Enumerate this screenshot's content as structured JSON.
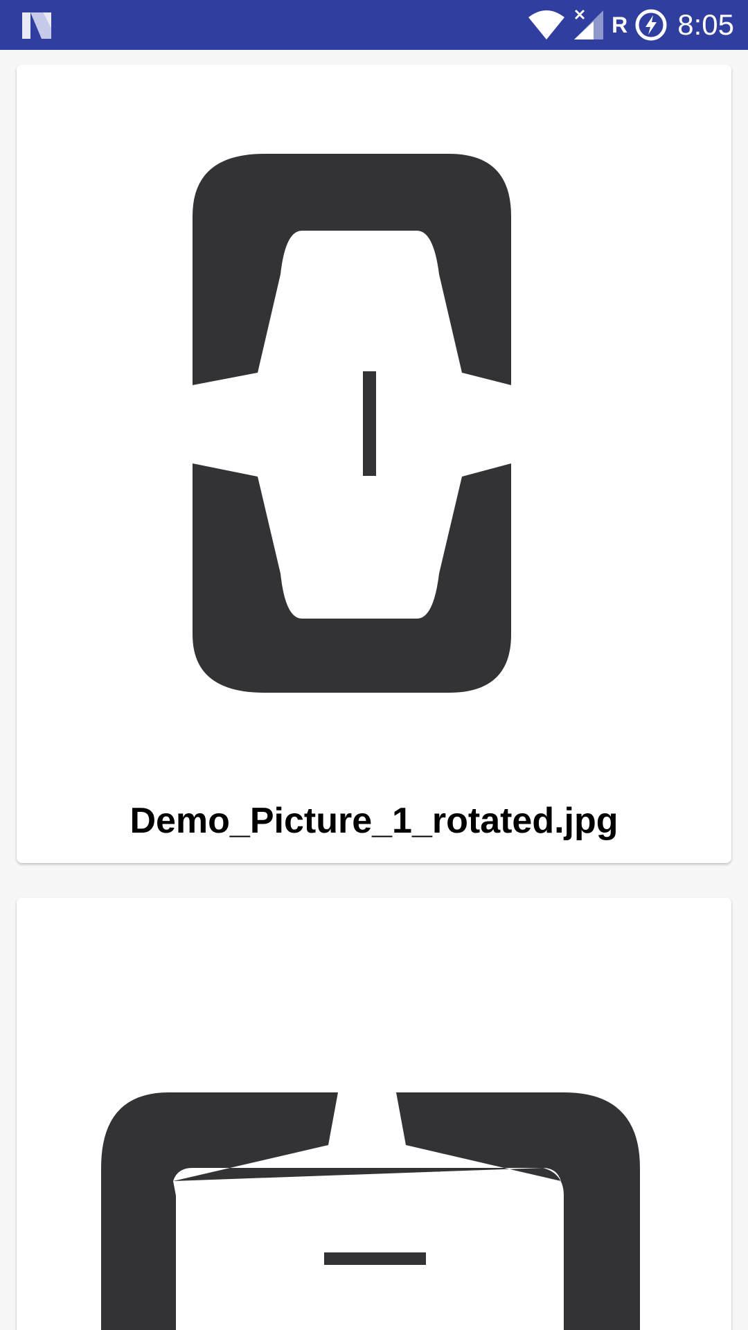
{
  "status_bar": {
    "time": "8:05",
    "network_letter": "R",
    "icons": [
      "n-logo-icon",
      "wifi-icon",
      "cell-signal-off-icon",
      "battery-charging-icon"
    ]
  },
  "cards": [
    {
      "title": "Demo_Picture_1_rotated.jpg",
      "image": "rotated-bracket-logo"
    },
    {
      "title": "",
      "image": "bracket-logo"
    }
  ],
  "colors": {
    "status_bar": "#303f9f",
    "background": "#f7f7f7",
    "logo": "#333234"
  }
}
